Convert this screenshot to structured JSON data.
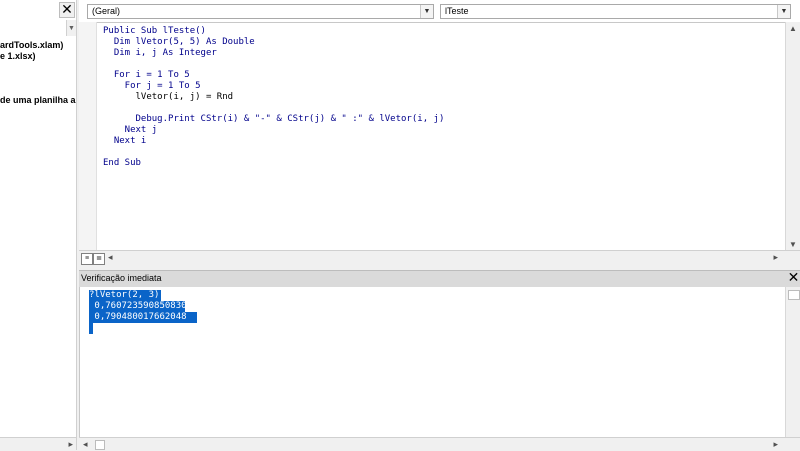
{
  "left_panel": {
    "lines": [
      "ardTools.xlam)",
      "e 1.xlsx)",
      "de uma planilha aut"
    ]
  },
  "code_window": {
    "object_combo": "(Geral)",
    "procedure_combo": "lTeste",
    "code_lines": [
      "Public Sub lTeste()",
      "  Dim lVetor(5, 5) As Double",
      "  Dim i, j As Integer",
      "",
      "  For i = 1 To 5",
      "    For j = 1 To 5",
      "      lVetor(i, j) = Rnd",
      "",
      "      Debug.Print CStr(i) & \"-\" & CStr(j) & \" :\" & lVetor(i, j)",
      "    Next j",
      "  Next i",
      "",
      "End Sub"
    ]
  },
  "immediate_window": {
    "title": "Verificação imediata",
    "lines": [
      "?lVetor(2, 3)",
      " 0,760723590850830 ",
      " 0,790480017662048 "
    ],
    "selection_color": "#0a64c8"
  },
  "icons": [
    "close-icon",
    "dropdown-arrow-icon",
    "scroll-arrow-icon",
    "procedure-view-icon",
    "full-module-view-icon"
  ]
}
